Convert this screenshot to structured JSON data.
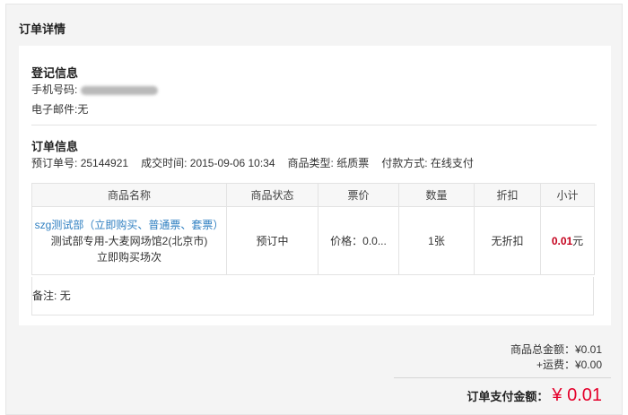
{
  "page": {
    "title": "订单详情"
  },
  "registration": {
    "title": "登记信息",
    "phone_label": "手机号码:",
    "email_label": "电子邮件:",
    "email_value": "无"
  },
  "order_info": {
    "title": "订单信息",
    "order_no_label": "预订单号:",
    "order_no": "25144921",
    "deal_time_label": "成交时间:",
    "deal_time": "2015-09-06 10:34",
    "product_type_label": "商品类型:",
    "product_type": "纸质票",
    "pay_method_label": "付款方式:",
    "pay_method": "在线支付"
  },
  "table": {
    "headers": [
      "商品名称",
      "商品状态",
      "票价",
      "数量",
      "折扣",
      "小计"
    ],
    "rows": [
      {
        "name_link": "szg测试部（立即购买、普通票、套票）",
        "name_line2": "测试部专用-大麦网场馆2(北京市)",
        "name_line3": "立即购买场次",
        "status": "预订中",
        "price": "价格：0.0...",
        "quantity": "1张",
        "discount": "无折扣",
        "subtotal_num": "0.01",
        "subtotal_unit": "元"
      }
    ]
  },
  "remark": {
    "label": "备注:",
    "value": "无"
  },
  "summary": {
    "goods_total": "商品总金额：¥0.01",
    "shipping": "+运费：¥0.00",
    "pay_label": "订单支付金额：",
    "pay_amount": "¥ 0.01"
  },
  "colors": {
    "accent_red": "#e4002b",
    "link_blue": "#2f7fc1"
  }
}
